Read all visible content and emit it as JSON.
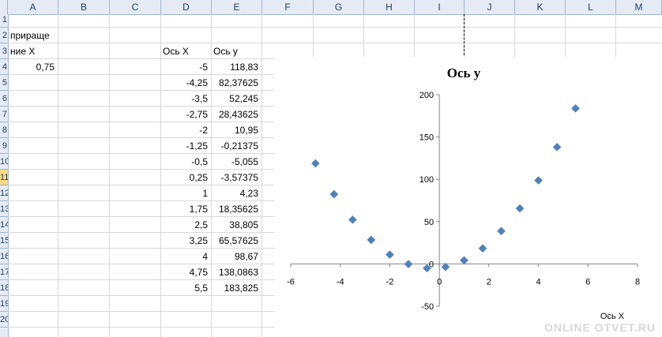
{
  "columns": [
    "A",
    "B",
    "C",
    "D",
    "E",
    "F",
    "G",
    "H",
    "I",
    "J",
    "K",
    "L",
    "M"
  ],
  "rows": [
    "1",
    "2",
    "3",
    "4",
    "5",
    "6",
    "7",
    "8",
    "9",
    "10",
    "11",
    "12",
    "13",
    "14",
    "15",
    "16",
    "17",
    "18",
    "19",
    "20"
  ],
  "selected_row": "11",
  "cells": {
    "a1": "прираще",
    "a2": "ние X",
    "a3": "0,75",
    "d2": "Ось X",
    "e2": "Ось у"
  },
  "table": {
    "x": [
      "-5",
      "-4,25",
      "-3,5",
      "-2,75",
      "-2",
      "-1,25",
      "-0,5",
      "0,25",
      "1",
      "1,75",
      "2,5",
      "3,25",
      "4",
      "4,75",
      "5,5"
    ],
    "y": [
      "118,83",
      "82,37625",
      "52,245",
      "28,43625",
      "10,95",
      "-0,21375",
      "-5,055",
      "-3,57375",
      "4,23",
      "18,35625",
      "38,805",
      "65,57625",
      "98,67",
      "138,0863",
      "183,825"
    ]
  },
  "chart_data": {
    "type": "scatter",
    "title": "Ось у",
    "xlabel": "Ось X",
    "ylabel": "",
    "x": [
      -5,
      -4.25,
      -3.5,
      -2.75,
      -2,
      -1.25,
      -0.5,
      0.25,
      1,
      1.75,
      2.5,
      3.25,
      4,
      4.75,
      5.5
    ],
    "y": [
      118.83,
      82.37625,
      52.245,
      28.43625,
      10.95,
      -0.21375,
      -5.055,
      -3.57375,
      4.23,
      18.35625,
      38.805,
      65.57625,
      98.67,
      138.0863,
      183.825
    ],
    "xlim": [
      -6,
      8
    ],
    "ylim": [
      -50,
      200
    ],
    "xticks": [
      -6,
      -4,
      -2,
      0,
      2,
      4,
      6,
      8
    ],
    "yticks": [
      -50,
      0,
      50,
      100,
      150,
      200
    ],
    "xtick_labels": [
      "-6",
      "-4",
      "-2",
      "0",
      "2",
      "4",
      "6",
      "8"
    ],
    "ytick_labels": [
      "-50",
      "0",
      "50",
      "100",
      "150",
      "200"
    ],
    "marker": "diamond",
    "marker_color": "#4f81bd",
    "grid": false,
    "legend": "none"
  },
  "watermark": "ONLINE OTVET.RU"
}
